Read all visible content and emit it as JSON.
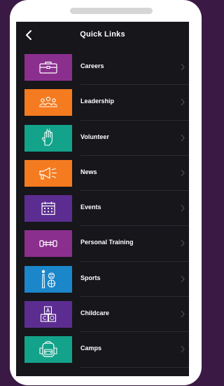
{
  "header": {
    "title": "Quick Links",
    "back_icon": "chevron-left-icon"
  },
  "items": [
    {
      "label": "Careers",
      "color": "#8b2f8f",
      "icon": "briefcase-icon"
    },
    {
      "label": "Leadership",
      "color": "#f47b20",
      "icon": "people-group-icon"
    },
    {
      "label": "Volunteer",
      "color": "#12a38a",
      "icon": "raised-hand-icon"
    },
    {
      "label": "News",
      "color": "#f47b20",
      "icon": "megaphone-icon"
    },
    {
      "label": "Events",
      "color": "#5c2d91",
      "icon": "calendar-icon"
    },
    {
      "label": "Personal Training",
      "color": "#8b2f8f",
      "icon": "dumbbell-icon"
    },
    {
      "label": "Sports",
      "color": "#1b86c9",
      "icon": "sports-balls-icon"
    },
    {
      "label": "Childcare",
      "color": "#5c2d91",
      "icon": "toy-blocks-icon"
    },
    {
      "label": "Camps",
      "color": "#12a38a",
      "icon": "backpack-icon"
    }
  ],
  "chevron_icon": "chevron-right-icon"
}
